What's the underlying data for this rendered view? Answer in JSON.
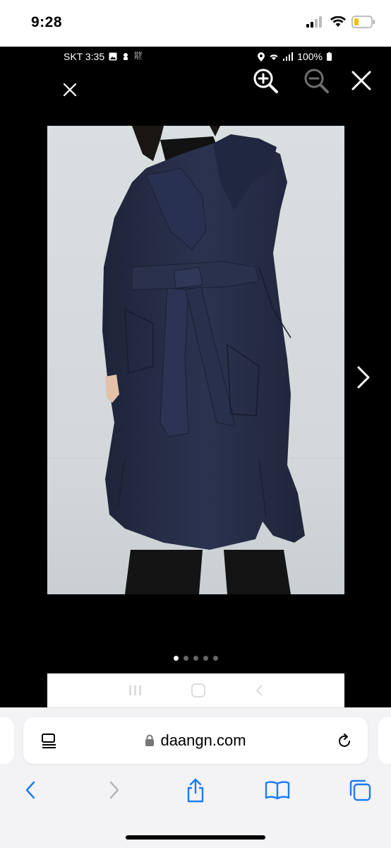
{
  "ios_status": {
    "time": "9:28"
  },
  "android_status": {
    "carrier_time": "SKT 3:35",
    "samsung_card": "삼성\n카드",
    "battery": "100%"
  },
  "viewer": {
    "pagination": {
      "total": 5,
      "active": 1
    }
  },
  "safari": {
    "url": "daangn.com"
  },
  "colors": {
    "coat": "#252c44",
    "background_photo": "#d7dcde",
    "safari_blue": "#1a7cf5"
  }
}
